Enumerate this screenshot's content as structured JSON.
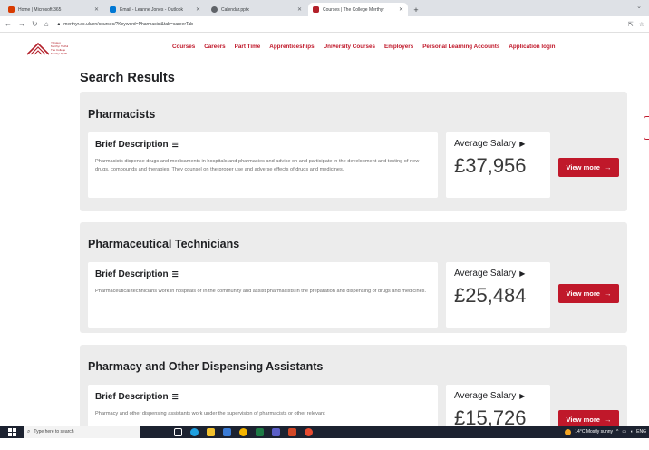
{
  "browser": {
    "tabs": [
      {
        "title": "Home | Microsoft 365",
        "icon_color": "#d83b01"
      },
      {
        "title": "Email - Leanne Jones - Outlook",
        "icon_color": "#0078d4"
      },
      {
        "title": "Calendar.pptx",
        "icon_color": "#5f6368"
      },
      {
        "title": "Courses | The College Merthyr",
        "icon_color": "#b3202a"
      }
    ],
    "new_tab": "+",
    "url": "merthyr.ac.uk/en/courses/?Keyword=Pharmacist&tab=careerTab"
  },
  "site": {
    "logo_lines": [
      "Y Coleg",
      "Merthyr Tudful",
      "The College",
      "Merthyr Tydfil"
    ],
    "nav": [
      "Courses",
      "Careers",
      "Part Time",
      "Apprenticeships",
      "University Courses",
      "Employers",
      "Personal Learning Accounts",
      "Application login"
    ],
    "brand_color": "#c0182a"
  },
  "page": {
    "title": "Search Results",
    "desc_label": "Brief Description",
    "salary_label": "Average Salary",
    "view_more": "View more"
  },
  "results": [
    {
      "title": "Pharmacists",
      "description": "Pharmacists dispense drugs and medicaments in hospitals and pharmacies and advise on and participate in the development and testing of new drugs, compounds and therapies. They counsel on the proper use and adverse effects of drugs and medicines.",
      "salary": "£37,956"
    },
    {
      "title": "Pharmaceutical Technicians",
      "description": "Pharmaceutical technicians work in hospitals or in the community and assist pharmacists in the preparation and dispensing of drugs and medicines.",
      "salary": "£25,484"
    },
    {
      "title": "Pharmacy and Other Dispensing Assistants",
      "description": "Pharmacy and other dispensing assistants work under the supervision of pharmacists or other relevant",
      "salary": "£15,726"
    }
  ],
  "taskbar": {
    "search_placeholder": "Type here to search",
    "weather": "14°C Mostly sunny",
    "lang": "ENG"
  }
}
